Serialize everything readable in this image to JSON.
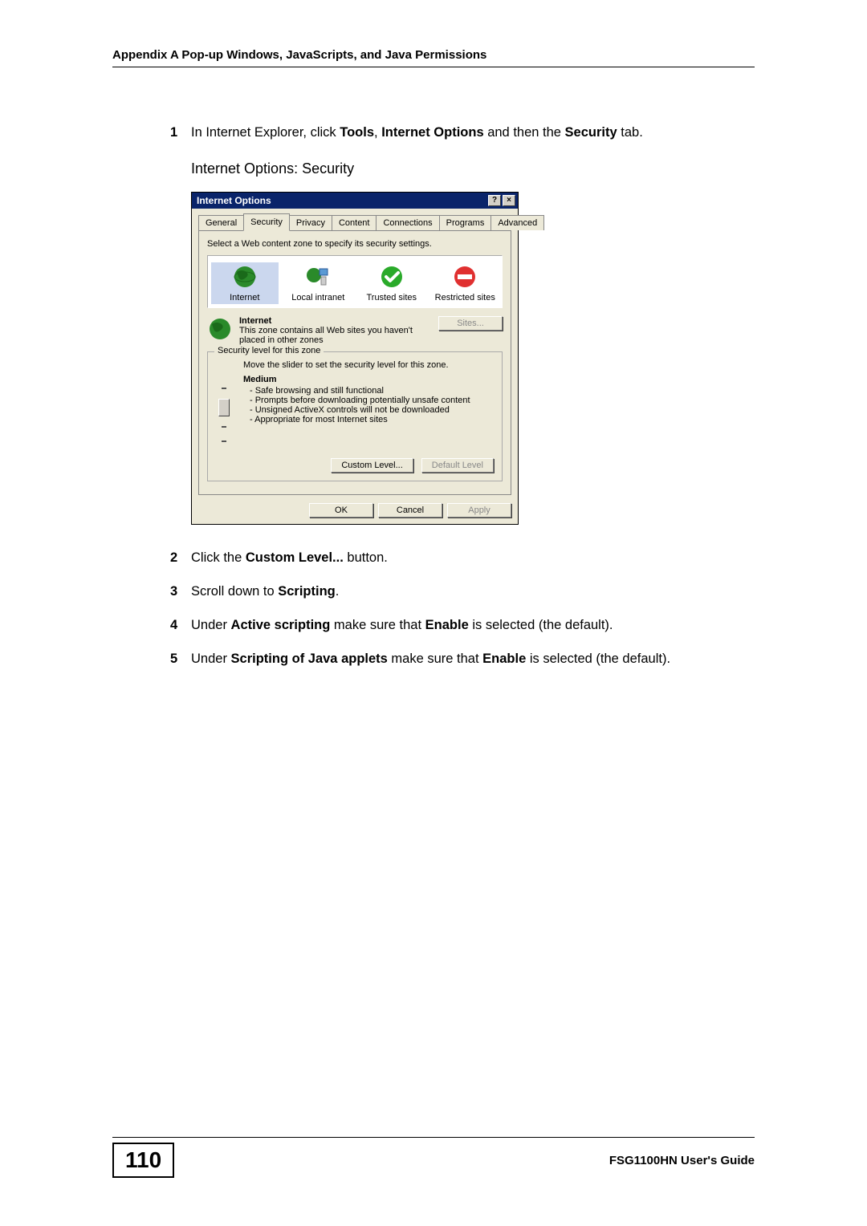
{
  "header": {
    "text": "Appendix A Pop-up Windows, JavaScripts, and Java Permissions"
  },
  "steps": {
    "s1": {
      "num": "1",
      "pre": "In Internet Explorer, click ",
      "b1": "Tools",
      "mid1": ", ",
      "b2": "Internet Options",
      "mid2": " and then the ",
      "b3": "Security",
      "post": " tab."
    },
    "caption": "Internet Options: Security",
    "s2": {
      "num": "2",
      "pre": "Click the ",
      "b1": "Custom Level...",
      "post": " button."
    },
    "s3": {
      "num": "3",
      "pre": "Scroll down to ",
      "b1": "Scripting",
      "post": "."
    },
    "s4": {
      "num": "4",
      "pre": "Under ",
      "b1": "Active scripting",
      "mid1": " make sure that ",
      "b2": "Enable",
      "post": " is selected (the default)."
    },
    "s5": {
      "num": "5",
      "pre": "Under ",
      "b1": "Scripting of Java applets",
      "mid1": " make sure that ",
      "b2": "Enable",
      "post": " is selected (the default)."
    }
  },
  "dialog": {
    "title": "Internet Options",
    "help": "?",
    "close": "×",
    "tabs": {
      "general": "General",
      "security": "Security",
      "privacy": "Privacy",
      "content": "Content",
      "connections": "Connections",
      "programs": "Programs",
      "advanced": "Advanced"
    },
    "instruction": "Select a Web content zone to specify its security settings.",
    "zones": {
      "internet": "Internet",
      "intranet": "Local intranet",
      "trusted": "Trusted sites",
      "restricted": "Restricted sites"
    },
    "zoneDesc": {
      "name": "Internet",
      "text": "This zone contains all Web sites you haven't placed in other zones",
      "sitesBtn": "Sites..."
    },
    "security": {
      "legend": "Security level for this zone",
      "move": "Move the slider to set the security level for this zone.",
      "level": "Medium",
      "l1": "- Safe browsing and still functional",
      "l2": "- Prompts before downloading potentially unsafe content",
      "l3": "- Unsigned ActiveX controls will not be downloaded",
      "l4": "- Appropriate for most Internet sites",
      "custom": "Custom Level...",
      "default": "Default Level"
    },
    "footer": {
      "ok": "OK",
      "cancel": "Cancel",
      "apply": "Apply"
    }
  },
  "footer": {
    "pageNum": "110",
    "guide": "FSG1100HN User's Guide"
  }
}
